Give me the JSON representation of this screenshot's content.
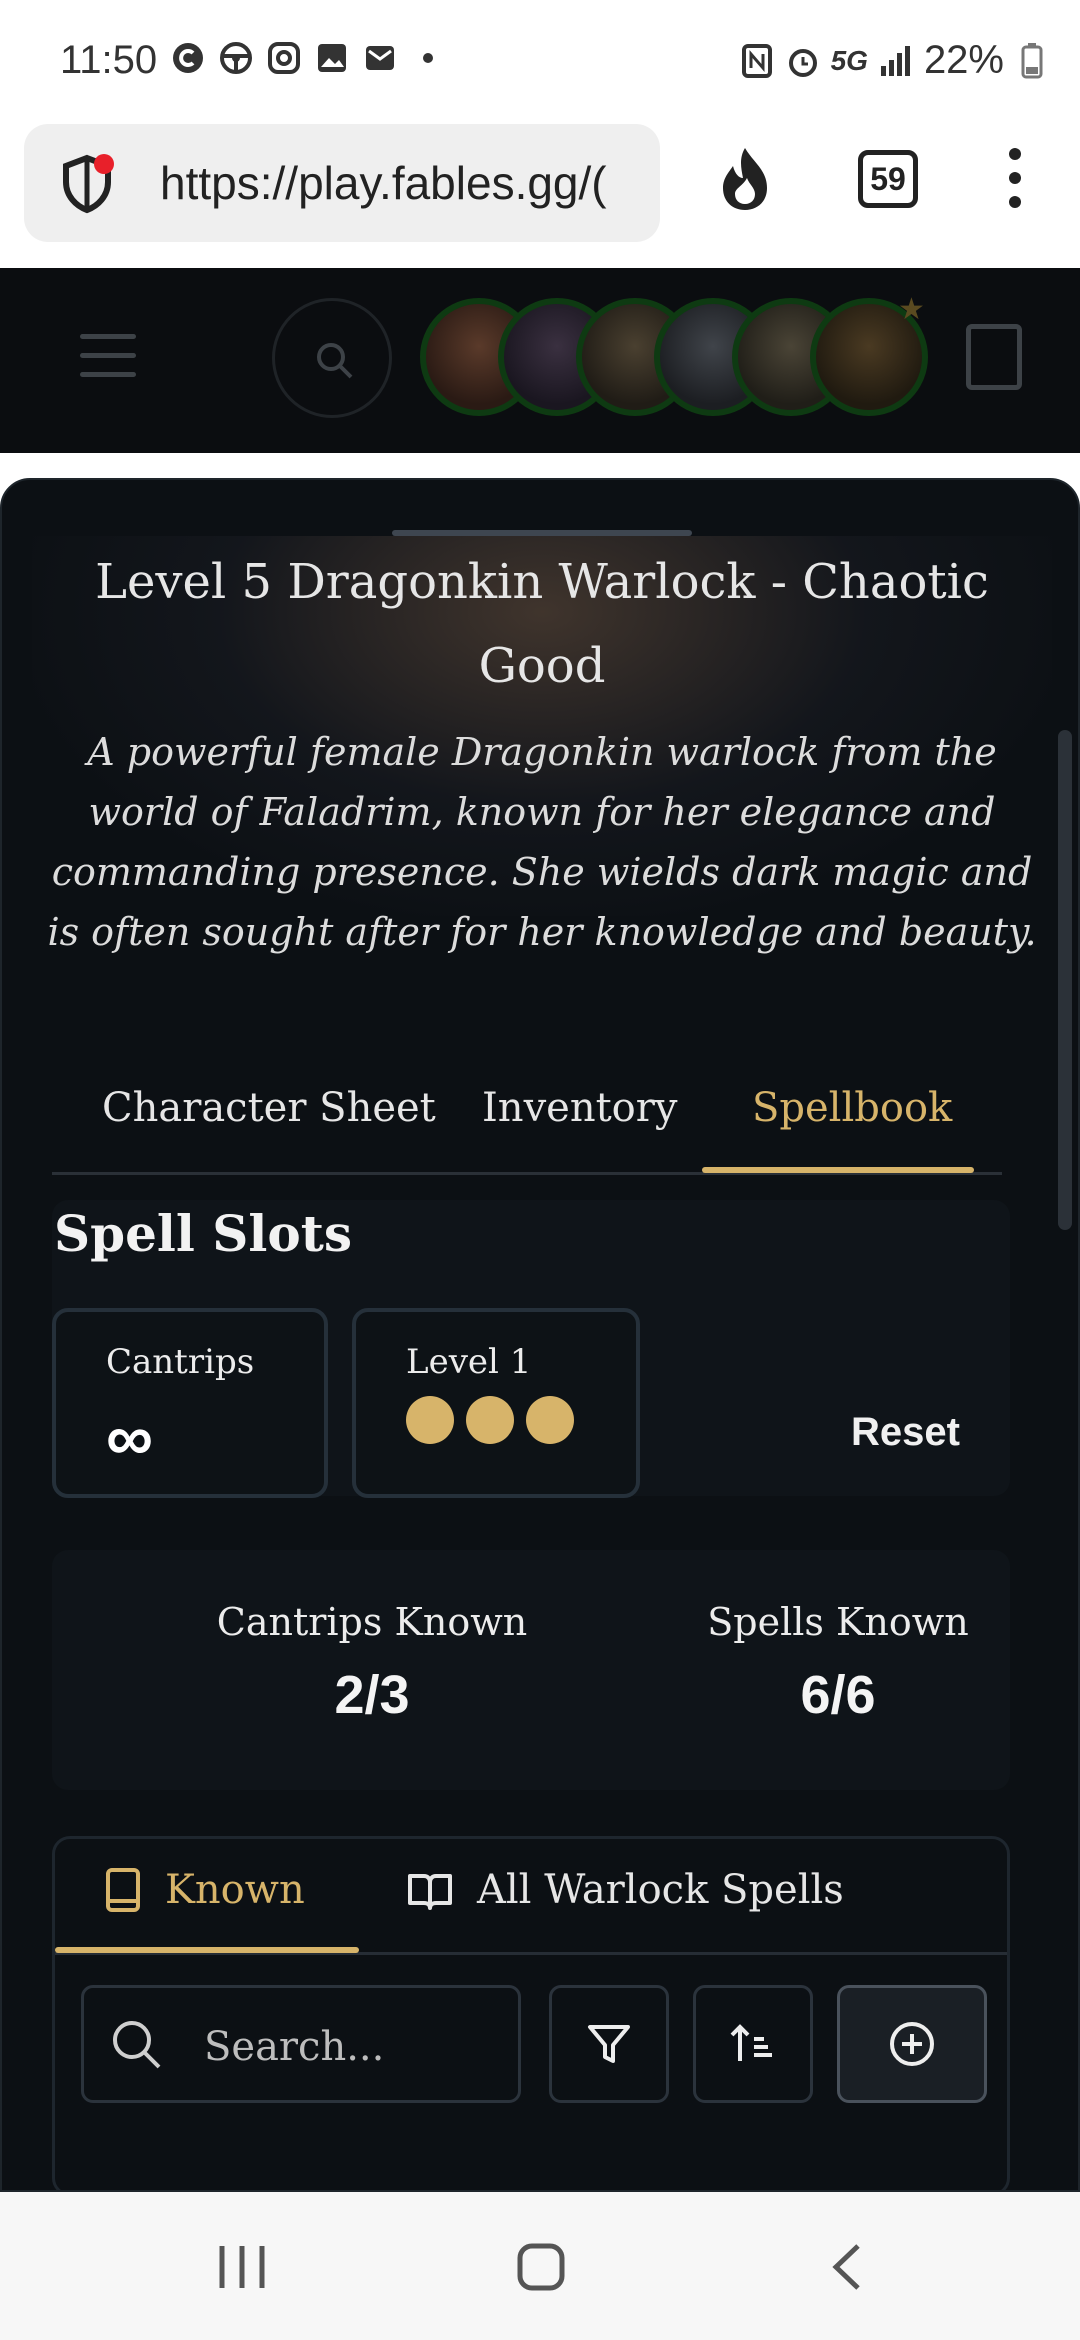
{
  "status_bar": {
    "time": "11:50",
    "network": "5G",
    "battery": "22%",
    "icons_left": [
      "c-app-icon",
      "steering-icon",
      "instagram-icon",
      "gallery-icon",
      "mail-icon",
      "dot-icon"
    ],
    "icons_right": [
      "nfc-icon",
      "alarm-icon",
      "signal-icon",
      "battery-icon"
    ]
  },
  "browser": {
    "url": "https://play.fables.gg/(",
    "tab_count": "59"
  },
  "character": {
    "title": "Level 5 Dragonkin Warlock - Chaotic Good",
    "description": "A powerful female Dragonkin warlock from the world of Faladrim, known for her elegance and commanding presence. She wields dark magic and is often sought after for her knowledge and beauty."
  },
  "main_tabs": [
    {
      "label": "Character Sheet",
      "active": false
    },
    {
      "label": "Inventory",
      "active": false
    },
    {
      "label": "Spellbook",
      "active": true
    }
  ],
  "spell_slots": {
    "title": "Spell Slots",
    "cantrips": {
      "label": "Cantrips",
      "value": "∞"
    },
    "level1": {
      "label": "Level 1",
      "remaining": 3,
      "total": 3
    },
    "reset_label": "Reset"
  },
  "known": {
    "cantrips_label": "Cantrips Known",
    "cantrips_value": "2/3",
    "spells_label": "Spells Known",
    "spells_value": "6/6"
  },
  "spell_list": {
    "tabs": [
      {
        "label": "Known",
        "active": true,
        "icon": "book-icon"
      },
      {
        "label": "All Warlock Spells",
        "active": false,
        "icon": "open-book-icon"
      }
    ],
    "search_placeholder": "Search..."
  },
  "colors": {
    "accent_gold": "#d7b46a",
    "panel_bg": "#0c1014"
  }
}
